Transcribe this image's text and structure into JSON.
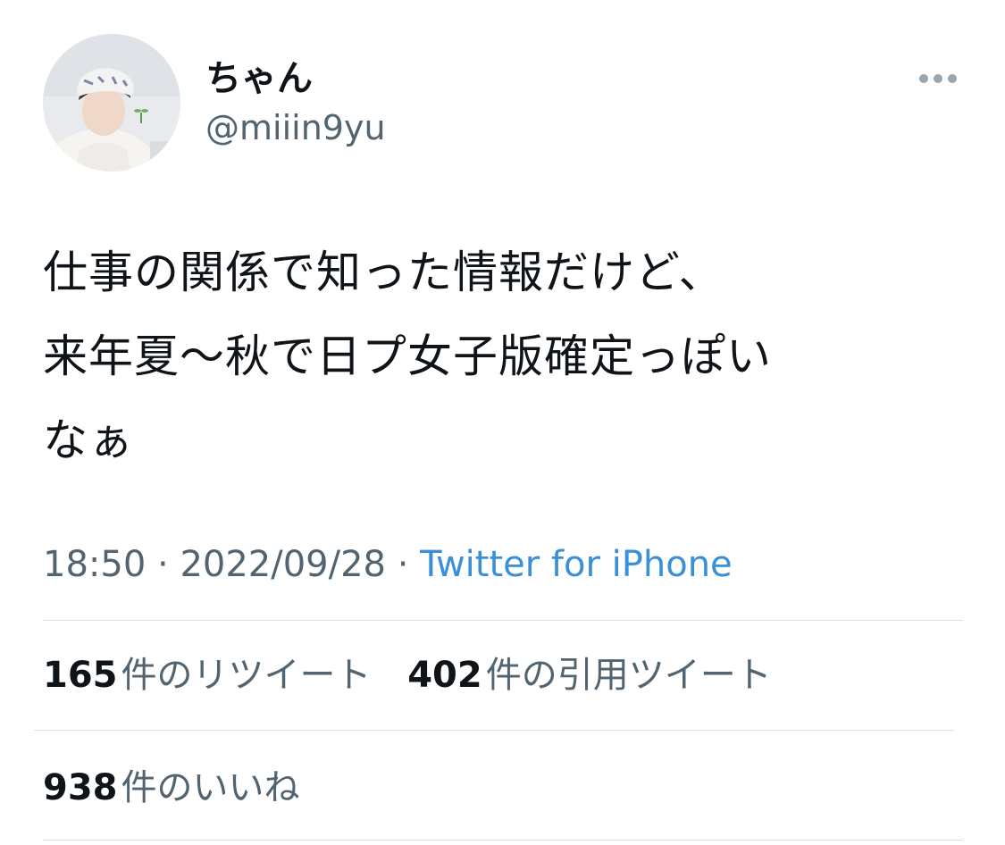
{
  "author": {
    "display_name": "ちゃん",
    "handle": "@miiin9yu"
  },
  "icons": {
    "more": "more-horizontal-icon"
  },
  "tweet": {
    "text": "仕事の関係で知った情報だけど、\n来年夏〜秋で日プ女子版確定っぽい\nなぁ"
  },
  "meta": {
    "time": "18:50",
    "separator": "·",
    "date": "2022/09/28",
    "source": "Twitter for iPhone"
  },
  "stats": {
    "retweets": {
      "count": "165",
      "label": "件のリツイート"
    },
    "quotes": {
      "count": "402",
      "label": "件の引用ツイート"
    },
    "likes": {
      "count": "938",
      "label": "件のいいね"
    }
  },
  "colors": {
    "text_primary": "#0f1419",
    "text_secondary": "#536471",
    "link": "#3a8fd9",
    "divider": "#dbdfe3"
  }
}
